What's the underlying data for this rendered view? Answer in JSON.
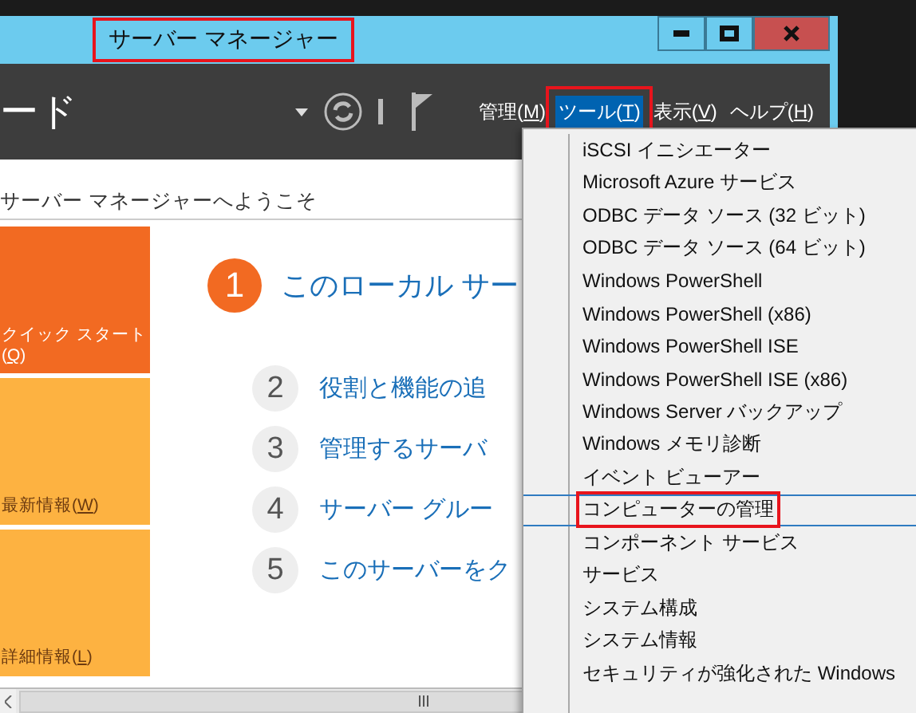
{
  "window": {
    "title": "サーバー マネージャー",
    "title_annotated": true
  },
  "header": {
    "title": "ード",
    "menus": [
      {
        "before": "管理(",
        "key": "M",
        "after": ")",
        "selected": false,
        "annotated": false
      },
      {
        "before": "ツール(",
        "key": "T",
        "after": ")",
        "selected": true,
        "annotated": true
      },
      {
        "before": "表示(",
        "key": "V",
        "after": ")",
        "selected": false,
        "annotated": false
      },
      {
        "before": "ヘルプ(",
        "key": "H",
        "after": ")",
        "selected": false,
        "annotated": false
      }
    ]
  },
  "welcome": "サーバー マネージャーへようこそ",
  "tiles": [
    {
      "before": "クイック スタート\n(",
      "key": "Q",
      "after": ")",
      "selected": true
    },
    {
      "before": "最新情報(",
      "key": "W",
      "after": ")",
      "selected": false
    },
    {
      "before": "詳細情報(",
      "key": "L",
      "after": ")",
      "selected": false
    }
  ],
  "steps": [
    {
      "number": "1",
      "text": "このローカル サー",
      "selected": true
    },
    {
      "number": "2",
      "text": "役割と機能の追",
      "selected": false
    },
    {
      "number": "3",
      "text": "管理するサーバ",
      "selected": false
    },
    {
      "number": "4",
      "text": "サーバー グルー",
      "selected": false
    },
    {
      "number": "5",
      "text": "このサーバーをク",
      "selected": false
    }
  ],
  "tools_menu": [
    {
      "label": "iSCSI イニシエーター",
      "selected": false,
      "annotated": false
    },
    {
      "label": "Microsoft Azure サービス",
      "selected": false,
      "annotated": false
    },
    {
      "label": "ODBC データ ソース (32 ビット)",
      "selected": false,
      "annotated": false
    },
    {
      "label": "ODBC データ ソース (64 ビット)",
      "selected": false,
      "annotated": false
    },
    {
      "label": "Windows PowerShell",
      "selected": false,
      "annotated": false
    },
    {
      "label": "Windows PowerShell (x86)",
      "selected": false,
      "annotated": false
    },
    {
      "label": "Windows PowerShell ISE",
      "selected": false,
      "annotated": false
    },
    {
      "label": "Windows PowerShell ISE (x86)",
      "selected": false,
      "annotated": false
    },
    {
      "label": "Windows Server バックアップ",
      "selected": false,
      "annotated": false
    },
    {
      "label": "Windows メモリ診断",
      "selected": false,
      "annotated": false
    },
    {
      "label": "イベント ビューアー",
      "selected": false,
      "annotated": false
    },
    {
      "label": "コンピューターの管理",
      "selected": true,
      "annotated": true
    },
    {
      "label": "コンポーネント サービス",
      "selected": false,
      "annotated": false
    },
    {
      "label": "サービス",
      "selected": false,
      "annotated": false
    },
    {
      "label": "システム構成",
      "selected": false,
      "annotated": false
    },
    {
      "label": "システム情報",
      "selected": false,
      "annotated": false
    },
    {
      "label": "セキュリティが強化された Windows",
      "selected": false,
      "annotated": false
    }
  ]
}
